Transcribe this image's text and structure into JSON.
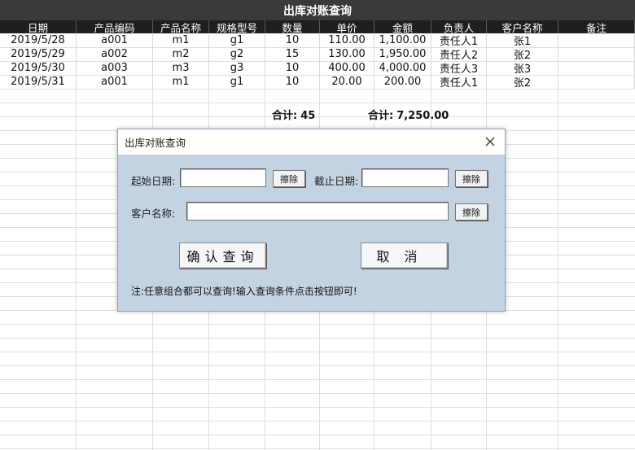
{
  "sheet": {
    "title": "出库对账查询",
    "columns": [
      "日期",
      "产品编码",
      "产品名称",
      "规格型号",
      "数量",
      "单价",
      "金额",
      "负责人",
      "客户名称",
      "备注"
    ],
    "rows": [
      [
        "2019/5/28",
        "a001",
        "m1",
        "g1",
        "10",
        "110.00",
        "1,100.00",
        "责任人1",
        "张1",
        ""
      ],
      [
        "2019/5/29",
        "a002",
        "m2",
        "g2",
        "15",
        "130.00",
        "1,950.00",
        "责任人2",
        "张2",
        ""
      ],
      [
        "2019/5/30",
        "a003",
        "m3",
        "g3",
        "10",
        "400.00",
        "4,000.00",
        "责任人3",
        "张3",
        ""
      ],
      [
        "2019/5/31",
        "a001",
        "m1",
        "g1",
        "10",
        "20.00",
        "200.00",
        "责任人1",
        "张2",
        ""
      ]
    ],
    "qty_total_label": "合计:",
    "qty_total_value": "45",
    "amount_total_label": "合计:",
    "amount_total_value": "7,250.00"
  },
  "dialog": {
    "title": "出库对账查询",
    "close_icon": "close-icon",
    "start_date_label": "起始日期:",
    "start_date_value": "",
    "end_date_label": "截止日期:",
    "end_date_value": "",
    "clear_label": "擦除",
    "customer_label": "客户名称:",
    "customer_value": "",
    "confirm_label": "确认查询",
    "cancel_label": "取消",
    "note": "注:任意组合都可以查询!输入查询条件点击按钮即可!"
  }
}
